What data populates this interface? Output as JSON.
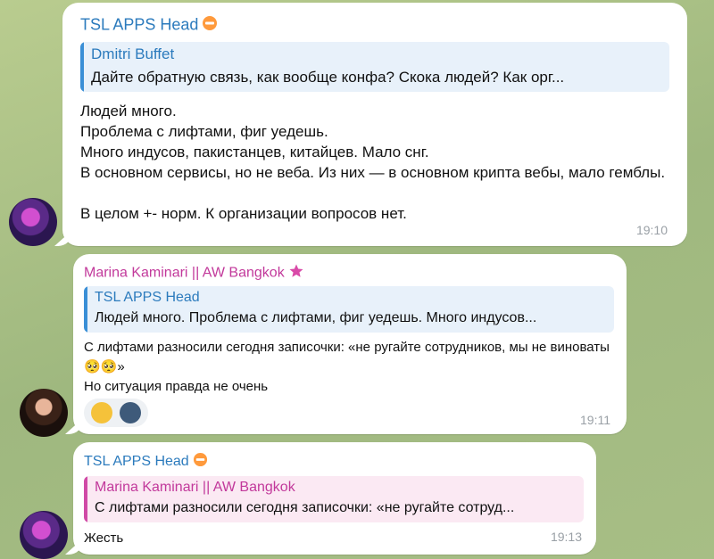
{
  "messages": [
    {
      "sender": "TSL APPS Head",
      "reply": {
        "name": "Dmitri Buffet",
        "text": "Дайте обратную связь, как вообще конфа? Скока людей? Как орг..."
      },
      "text": "Людей много.\nПроблема с лифтами, фиг уедешь.\nМного индусов, пакистанцев, китайцев. Мало снг.\nВ основном сервисы, но не веба. Из них — в основном крипта вебы, мало гемблы.\n\nВ целом +- норм. К организации вопросов нет.",
      "time": "19:10"
    },
    {
      "sender": "Marina Kaminari || AW Bangkok",
      "reply": {
        "name": "TSL APPS Head",
        "text": "Людей много.  Проблема с лифтами, фиг уедешь.  Много индусов..."
      },
      "text": "С лифтами разносили сегодня записочки: «не ругайте сотрудников, мы не виноваты 🥺🥺»\nНо ситуация правда не очень",
      "time": "19:11",
      "reactions": [
        "🤔",
        "🧑‍💻"
      ]
    },
    {
      "sender": "TSL APPS Head",
      "reply": {
        "name": "Marina Kaminari || AW Bangkok",
        "text": "С лифтами разносили сегодня записочки: «не ругайте сотруд..."
      },
      "text": "Жесть",
      "time": "19:13"
    }
  ],
  "colors": {
    "tsl_name": "#2c7bbd",
    "marina_name": "#c2399b",
    "reply_blue_bg": "#e8f1fa",
    "reply_blue_bar": "#3a8fd6",
    "reply_pink_bg": "#fbe9f3",
    "reply_pink_bar": "#d04aa6"
  },
  "icons": {
    "tsl_badge": "minus-circle-emoji-icon",
    "marina_badge": "star-icon"
  }
}
